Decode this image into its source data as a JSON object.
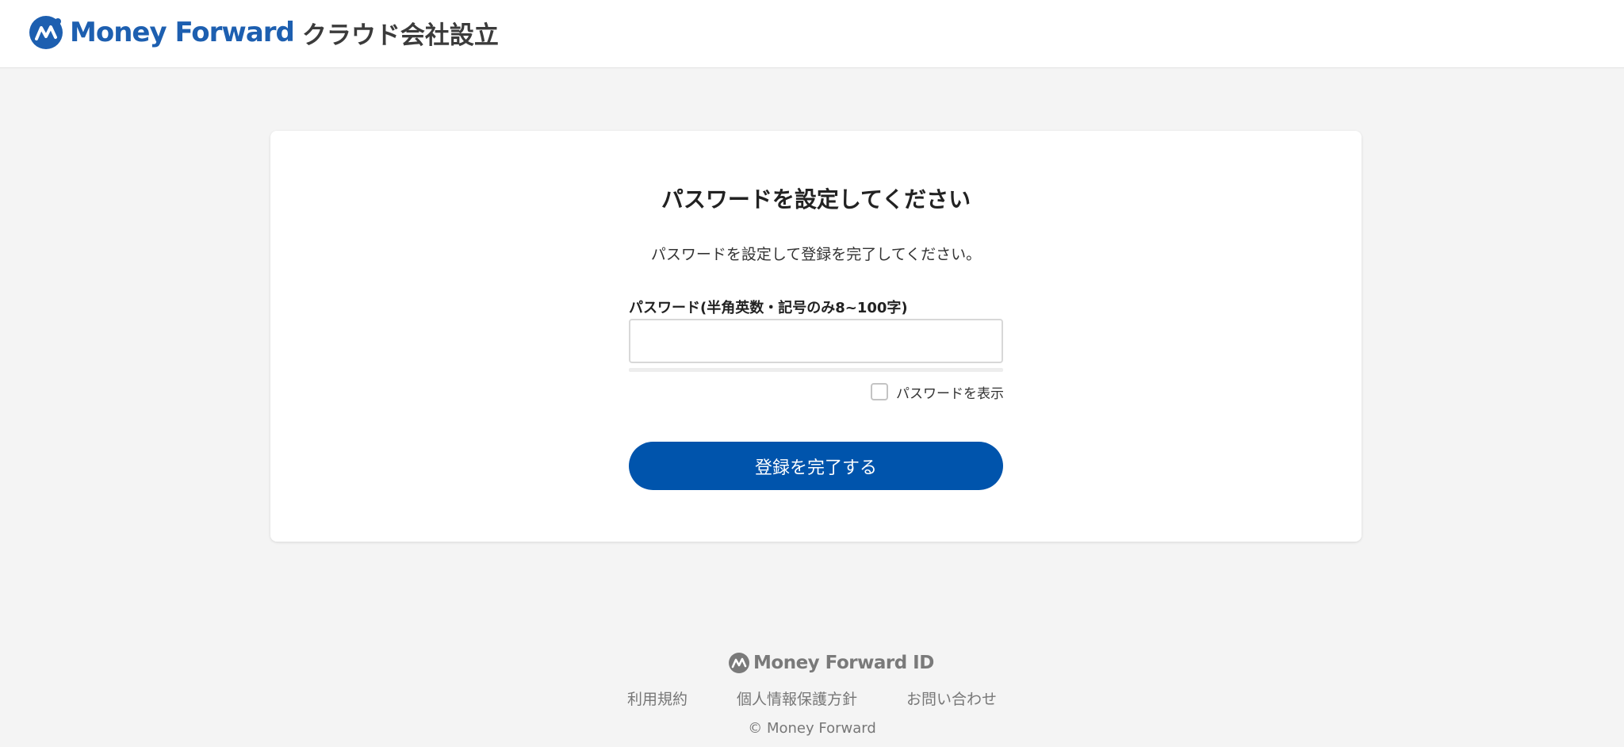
{
  "header": {
    "brand": "Money Forward",
    "product": "クラウド会社設立",
    "brand_color": "#1d5fb0"
  },
  "form": {
    "title": "パスワードを設定してください",
    "description": "パスワードを設定して登録を完了してください。",
    "password_label": "パスワード(半角英数・記号のみ8~100字)",
    "password_value": "",
    "show_password_label": "パスワードを表示",
    "show_password_checked": false,
    "submit_label": "登録を完了する",
    "submit_color": "#0054ac"
  },
  "footer": {
    "brand": "Money Forward ID",
    "links": [
      {
        "label": "利用規約"
      },
      {
        "label": "個人情報保護方針"
      },
      {
        "label": "お問い合わせ"
      }
    ],
    "copyright": "© Money Forward"
  }
}
